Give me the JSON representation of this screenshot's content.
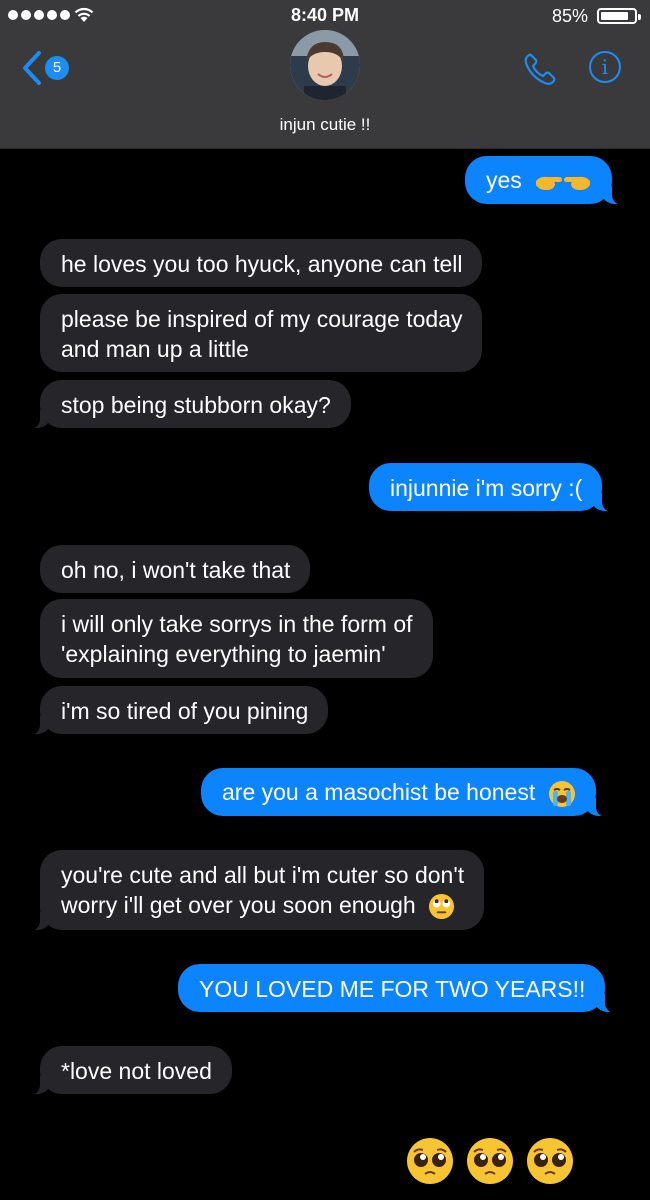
{
  "status_bar": {
    "time": "8:40 PM",
    "battery": "85%",
    "battery_level": 0.85
  },
  "header": {
    "back_count": "5",
    "contact_name": "injun cutie !!"
  },
  "messages": [
    {
      "from": "me",
      "text": "yes",
      "emoji": "backhand-index-pointing-right and left"
    },
    {
      "from": "them",
      "text": "he loves you too hyuck, anyone can tell"
    },
    {
      "from": "them",
      "lines": [
        "please be inspired of my courage today",
        "and man up a little"
      ]
    },
    {
      "from": "them",
      "text": "stop being stubborn okay?"
    },
    {
      "from": "me",
      "text": "injunnie i'm sorry :("
    },
    {
      "from": "them",
      "text": "oh no, i won't take that"
    },
    {
      "from": "them",
      "lines": [
        "i will only take sorrys in the form of",
        "'explaining everything to jaemin'"
      ]
    },
    {
      "from": "them",
      "text": "i'm so tired of you pining"
    },
    {
      "from": "me",
      "text": "are you a masochist be honest",
      "emoji": "loudly-crying-face"
    },
    {
      "from": "them",
      "lines": [
        "you're cute and all but i'm cuter so don't",
        "worry i'll get over you soon enough"
      ],
      "emoji": "face-with-rolling-eyes"
    },
    {
      "from": "me",
      "text": "YOU LOVED ME FOR TWO YEARS!!"
    },
    {
      "from": "them",
      "text": "*love not loved"
    }
  ],
  "big_emoji_message": {
    "from": "me",
    "emoji": "pleading-face",
    "count": 3
  },
  "colors": {
    "sent_bubble": "#0b84fe",
    "received_bubble": "#26252a",
    "accent": "#1d8cf3",
    "header_bg": "#3a3a3c"
  }
}
